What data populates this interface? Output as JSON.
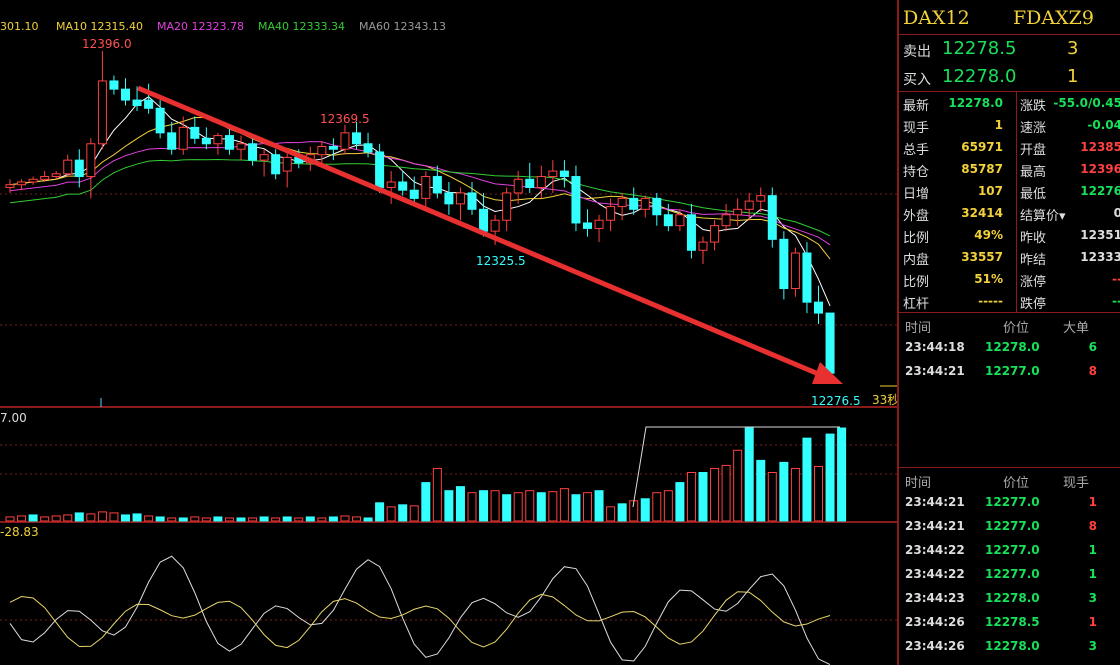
{
  "chart_data": {
    "type": "candlestick",
    "symbol": "DAX12",
    "code": "FDAXZ9",
    "ma_labels": [
      {
        "name": "MA10",
        "value": "12315.40",
        "color": "#f2d13a"
      },
      {
        "name": "MA20",
        "value": "12323.78",
        "color": "#e040e0"
      },
      {
        "name": "MA40",
        "value": "12333.34",
        "color": "#33cc33"
      },
      {
        "name": "MA60",
        "value": "12343.13",
        "color": "#999999"
      }
    ],
    "ma_prefix": "301.10",
    "annotations": {
      "high": "12396.0",
      "peak2": "12369.5",
      "trough": "12325.5",
      "last_low": "12276.5",
      "countdown": "33秒"
    },
    "volume_label": "7.00",
    "indicator_label": "-28.83",
    "y_range": [
      12270,
      12400
    ],
    "candles": [
      [
        12346,
        12349,
        12344,
        12347
      ],
      [
        12347,
        12349,
        12345,
        12348
      ],
      [
        12348,
        12350,
        12347,
        12349
      ],
      [
        12349,
        12352,
        12348,
        12350
      ],
      [
        12350,
        12352,
        12349,
        12351
      ],
      [
        12351,
        12358,
        12350,
        12356
      ],
      [
        12356,
        12360,
        12346,
        12350
      ],
      [
        12350,
        12364,
        12342,
        12362
      ],
      [
        12362,
        12396,
        12360,
        12385
      ],
      [
        12385,
        12387,
        12380,
        12382
      ],
      [
        12382,
        12386,
        12376,
        12378
      ],
      [
        12378,
        12383,
        12374,
        12376
      ],
      [
        12378,
        12384,
        12373,
        12375
      ],
      [
        12375,
        12378,
        12364,
        12366
      ],
      [
        12366,
        12370,
        12358,
        12360
      ],
      [
        12360,
        12372,
        12358,
        12368
      ],
      [
        12368,
        12372,
        12362,
        12364
      ],
      [
        12364,
        12368,
        12360,
        12362
      ],
      [
        12362,
        12366,
        12358,
        12365
      ],
      [
        12365,
        12368,
        12358,
        12360
      ],
      [
        12360,
        12365,
        12356,
        12362
      ],
      [
        12362,
        12364,
        12354,
        12356
      ],
      [
        12356,
        12360,
        12350,
        12358
      ],
      [
        12358,
        12360,
        12349,
        12351
      ],
      [
        12352,
        12359,
        12346,
        12357
      ],
      [
        12357,
        12360,
        12353,
        12355
      ],
      [
        12355,
        12361,
        12352,
        12358
      ],
      [
        12358,
        12363,
        12354,
        12361
      ],
      [
        12361,
        12364,
        12356,
        12360
      ],
      [
        12360,
        12369,
        12358,
        12366
      ],
      [
        12366,
        12370,
        12360,
        12362
      ],
      [
        12362,
        12366,
        12357,
        12359
      ],
      [
        12359,
        12362,
        12344,
        12346
      ],
      [
        12346,
        12352,
        12340,
        12348
      ],
      [
        12348,
        12352,
        12343,
        12345
      ],
      [
        12345,
        12350,
        12340,
        12342
      ],
      [
        12342,
        12352,
        12338,
        12350
      ],
      [
        12350,
        12354,
        12342,
        12344
      ],
      [
        12344,
        12348,
        12336,
        12340
      ],
      [
        12340,
        12346,
        12334,
        12344
      ],
      [
        12344,
        12348,
        12336,
        12338
      ],
      [
        12338,
        12344,
        12328,
        12330
      ],
      [
        12330,
        12336,
        12325,
        12334
      ],
      [
        12334,
        12346,
        12330,
        12344
      ],
      [
        12344,
        12352,
        12340,
        12349
      ],
      [
        12349,
        12355,
        12344,
        12346
      ],
      [
        12346,
        12354,
        12342,
        12350
      ],
      [
        12350,
        12356,
        12344,
        12352
      ],
      [
        12352,
        12356,
        12346,
        12350
      ],
      [
        12350,
        12354,
        12330,
        12333
      ],
      [
        12333,
        12338,
        12328,
        12331
      ],
      [
        12331,
        12336,
        12326,
        12334
      ],
      [
        12334,
        12342,
        12330,
        12339
      ],
      [
        12339,
        12344,
        12334,
        12342
      ],
      [
        12342,
        12346,
        12336,
        12338
      ],
      [
        12338,
        12343,
        12335,
        12342
      ],
      [
        12342,
        12344,
        12332,
        12336
      ],
      [
        12336,
        12340,
        12330,
        12332
      ],
      [
        12332,
        12338,
        12330,
        12336
      ],
      [
        12336,
        12340,
        12320,
        12323
      ],
      [
        12323,
        12328,
        12318,
        12326
      ],
      [
        12326,
        12334,
        12323,
        12332
      ],
      [
        12332,
        12340,
        12330,
        12336
      ],
      [
        12336,
        12342,
        12332,
        12338
      ],
      [
        12338,
        12344,
        12334,
        12341
      ],
      [
        12341,
        12346,
        12337,
        12343
      ],
      [
        12343,
        12346,
        12324,
        12327
      ],
      [
        12327,
        12330,
        12305,
        12309
      ],
      [
        12309,
        12324,
        12306,
        12322
      ],
      [
        12322,
        12326,
        12300,
        12304
      ],
      [
        12304,
        12310,
        12296,
        12300
      ],
      [
        12300,
        12300,
        12276,
        12278
      ]
    ],
    "volumes": [
      4,
      5,
      6,
      4,
      5,
      6,
      8,
      7,
      9,
      8,
      6,
      7,
      5,
      4,
      3,
      3,
      4,
      3,
      4,
      3,
      3,
      3,
      4,
      3,
      4,
      3,
      4,
      3,
      4,
      5,
      4,
      3,
      18,
      14,
      16,
      15,
      38,
      52,
      30,
      34,
      28,
      30,
      30,
      26,
      28,
      30,
      28,
      29,
      32,
      26,
      28,
      30,
      14,
      17,
      20,
      22,
      28,
      30,
      38,
      48,
      48,
      52,
      55,
      70,
      92,
      60,
      48,
      58,
      52,
      82,
      54,
      86,
      92
    ],
    "volume_is_up": [
      1,
      1,
      0,
      1,
      1,
      1,
      0,
      1,
      1,
      1,
      0,
      0,
      1,
      0,
      1,
      0,
      1,
      1,
      0,
      1,
      0,
      1,
      0,
      1,
      0,
      1,
      0,
      1,
      0,
      1,
      1,
      0,
      0,
      1,
      0,
      1,
      0,
      1,
      0,
      0,
      1,
      0,
      1,
      0,
      1,
      1,
      0,
      1,
      1,
      0,
      1,
      0,
      1,
      0,
      1,
      0,
      1,
      1,
      0,
      1,
      0,
      1,
      1,
      1,
      0,
      0,
      1,
      0,
      1,
      0,
      1,
      0,
      0
    ]
  },
  "panel": {
    "symbol": "DAX12",
    "code": "FDAXZ9",
    "ask": {
      "label": "卖出",
      "price": "12278.5",
      "qty": "3"
    },
    "bid": {
      "label": "买入",
      "price": "12278.0",
      "qty": "1"
    },
    "stats": [
      {
        "k1": "最新",
        "v1": "12278.0",
        "c1": "green",
        "k2": "涨跌",
        "v2": "-55.0/0.45",
        "c2": "green"
      },
      {
        "k1": "现手",
        "v1": "1",
        "c1": "yellow",
        "k2": "速涨",
        "v2": "-0.04",
        "c2": "green"
      },
      {
        "k1": "总手",
        "v1": "65971",
        "c1": "yellow",
        "k2": "开盘",
        "v2": "12385",
        "c2": "red"
      },
      {
        "k1": "持仓",
        "v1": "85787",
        "c1": "yellow",
        "k2": "最高",
        "v2": "12396",
        "c2": "red"
      },
      {
        "k1": "日增",
        "v1": "107",
        "c1": "yellow",
        "k2": "最低",
        "v2": "12276",
        "c2": "green"
      },
      {
        "k1": "外盘",
        "v1": "32414",
        "c1": "yellow",
        "k2": "结算价▾",
        "v2": "0",
        "c2": "white"
      },
      {
        "k1": "比例",
        "v1": "49%",
        "c1": "yellow",
        "k2": "昨收",
        "v2": "12351",
        "c2": "white"
      },
      {
        "k1": "内盘",
        "v1": "33557",
        "c1": "yellow",
        "k2": "昨结",
        "v2": "12333",
        "c2": "white"
      },
      {
        "k1": "比例",
        "v1": "51%",
        "c1": "yellow",
        "k2": "涨停",
        "v2": "--",
        "c2": "red"
      },
      {
        "k1": "杠杆",
        "v1": "-----",
        "c1": "yellow",
        "k2": "跌停",
        "v2": "--",
        "c2": "green"
      }
    ],
    "big_header": {
      "time": "时间",
      "price": "价位",
      "vol": "大单"
    },
    "big_orders": [
      {
        "time": "23:44:18",
        "price": "12278.0",
        "vol": "6",
        "color": "green"
      },
      {
        "time": "23:44:21",
        "price": "12277.0",
        "vol": "8",
        "color": "red"
      }
    ],
    "ticks_header": {
      "time": "时间",
      "price": "价位",
      "vol": "现手"
    },
    "ticks": [
      {
        "time": "23:44:21",
        "price": "12277.0",
        "vol": "1",
        "color": "red"
      },
      {
        "time": "23:44:21",
        "price": "12277.0",
        "vol": "8",
        "color": "red"
      },
      {
        "time": "23:44:22",
        "price": "12277.0",
        "vol": "1",
        "color": "green"
      },
      {
        "time": "23:44:22",
        "price": "12277.0",
        "vol": "1",
        "color": "green"
      },
      {
        "time": "23:44:23",
        "price": "12278.0",
        "vol": "3",
        "color": "green"
      },
      {
        "time": "23:44:26",
        "price": "12278.5",
        "vol": "1",
        "color": "red"
      },
      {
        "time": "23:44:26",
        "price": "12278.0",
        "vol": "3",
        "color": "green"
      }
    ]
  }
}
